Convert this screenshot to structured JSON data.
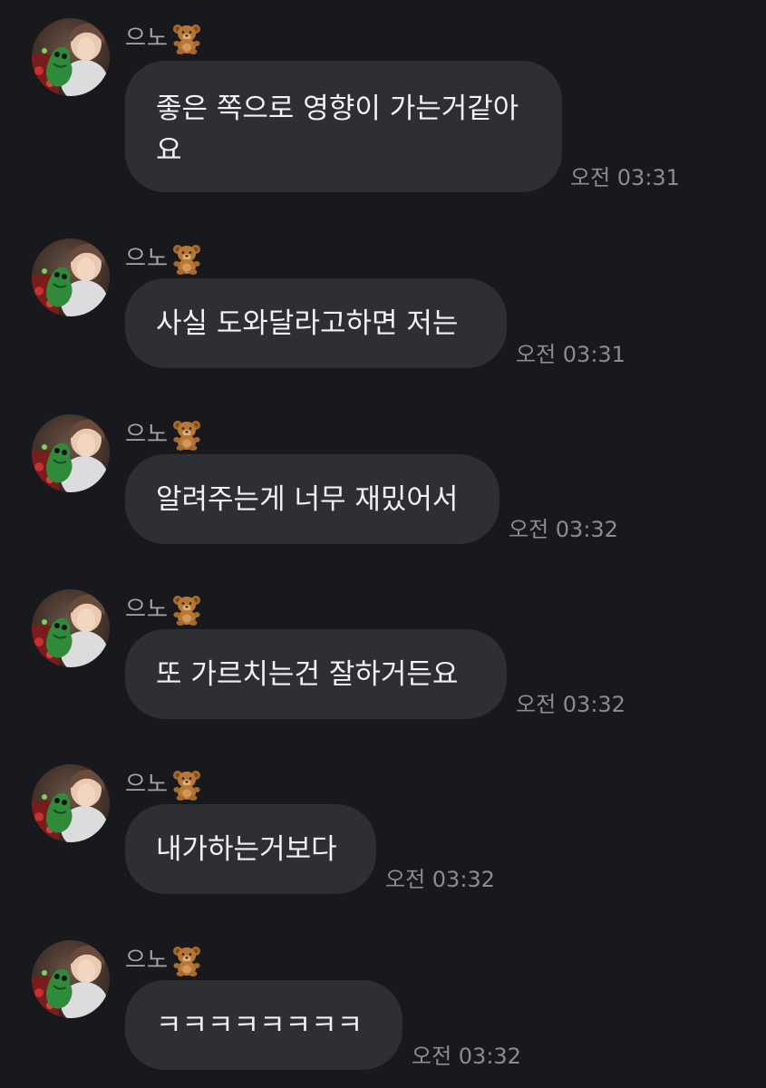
{
  "sender": {
    "name": "으노",
    "emoji": "🧸"
  },
  "messages": [
    {
      "text": "좋은 쪽으로 영향이 가는거같아\n요",
      "time": "오전 03:31"
    },
    {
      "text": "사실 도와달라고하면 저는",
      "time": "오전 03:31"
    },
    {
      "text": "알려주는게 너무 재밌어서",
      "time": "오전 03:32"
    },
    {
      "text": "또 가르치는건 잘하거든요",
      "time": "오전 03:32"
    },
    {
      "text": "내가하는거보다",
      "time": "오전 03:32"
    },
    {
      "text": "ㅋㅋㅋㅋㅋㅋㅋㅋ",
      "time": "오전 03:32"
    }
  ]
}
